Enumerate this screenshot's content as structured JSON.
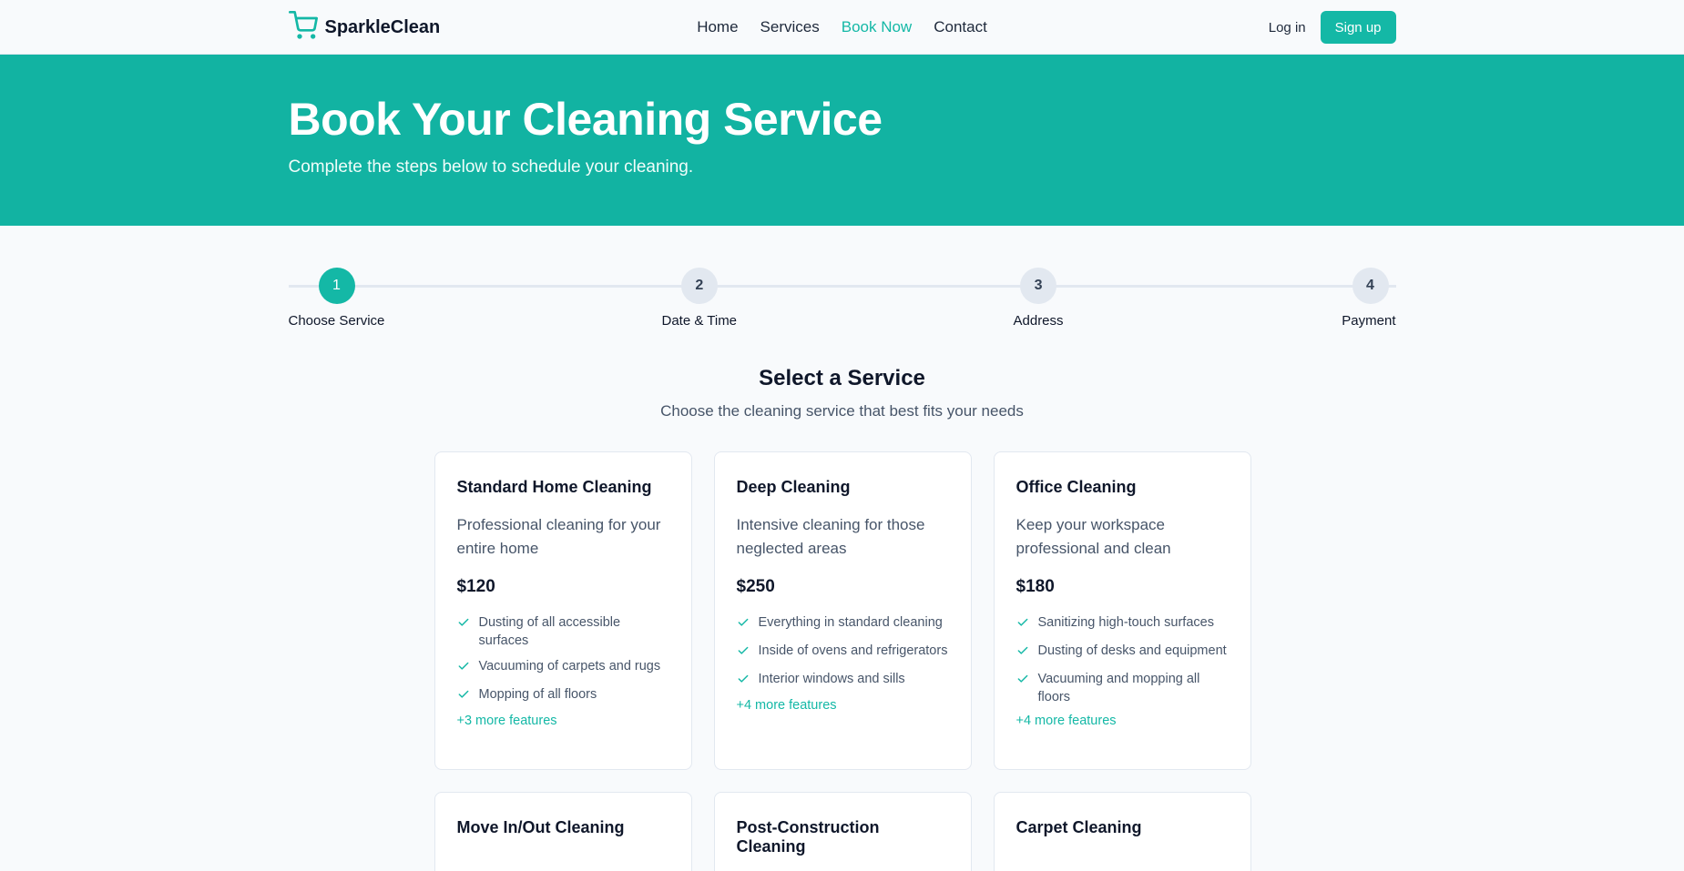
{
  "nav": {
    "brand": "SparkleClean",
    "links": [
      "Home",
      "Services",
      "Book Now",
      "Contact"
    ],
    "active_link": "Book Now",
    "login": "Log in",
    "signup": "Sign up"
  },
  "hero": {
    "title": "Book Your Cleaning Service",
    "subtitle": "Complete the steps below to schedule your cleaning."
  },
  "steps": [
    {
      "number": "1",
      "label": "Choose Service",
      "active": true
    },
    {
      "number": "2",
      "label": "Date & Time",
      "active": false
    },
    {
      "number": "3",
      "label": "Address",
      "active": false
    },
    {
      "number": "4",
      "label": "Payment",
      "active": false
    }
  ],
  "section": {
    "title": "Select a Service",
    "subtitle": "Choose the cleaning service that best fits your needs"
  },
  "services": [
    {
      "name": "Standard Home Cleaning",
      "description": "Professional cleaning for your entire home",
      "price": "$120",
      "features": [
        "Dusting of all accessible surfaces",
        "Vacuuming of carpets and rugs",
        "Mopping of all floors"
      ],
      "more": "+3 more features"
    },
    {
      "name": "Deep Cleaning",
      "description": "Intensive cleaning for those neglected areas",
      "price": "$250",
      "features": [
        "Everything in standard cleaning",
        "Inside of ovens and refrigerators",
        "Interior windows and sills"
      ],
      "more": "+4 more features"
    },
    {
      "name": "Office Cleaning",
      "description": "Keep your workspace professional and clean",
      "price": "$180",
      "features": [
        "Sanitizing high-touch surfaces",
        "Dusting of desks and equipment",
        "Vacuuming and mopping all floors"
      ],
      "more": "+4 more features"
    },
    {
      "name": "Move In/Out Cleaning"
    },
    {
      "name": "Post-Construction Cleaning"
    },
    {
      "name": "Carpet Cleaning"
    }
  ],
  "colors": {
    "accent": "#14b8a6",
    "hero_bg": "#12b3a2"
  },
  "icons": {
    "brand": "shopping-cart-icon",
    "feature": "check-icon"
  }
}
